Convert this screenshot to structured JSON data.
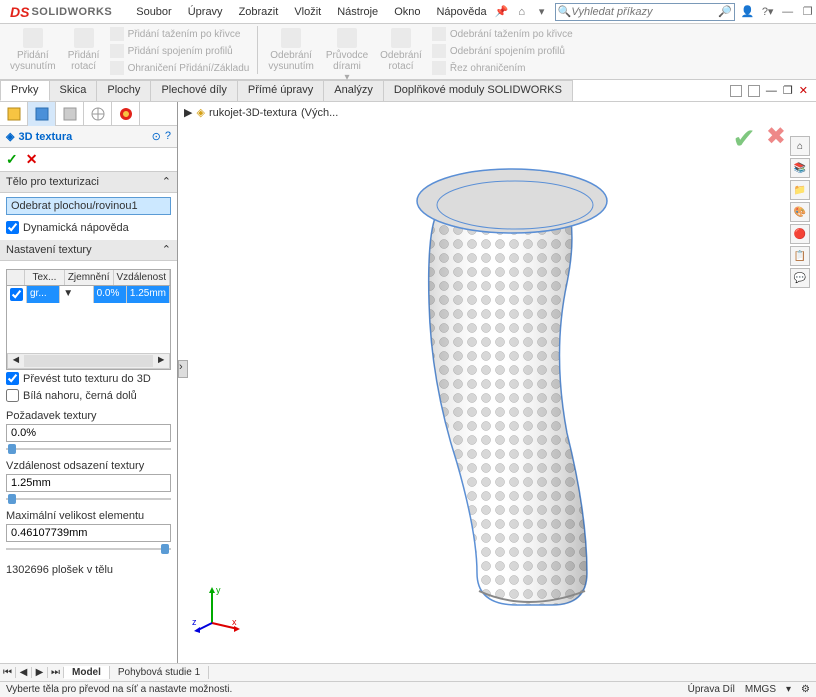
{
  "app": {
    "logo_prefix": "DS",
    "logo_name": "SOLIDWORKS"
  },
  "menu": [
    "Soubor",
    "Úpravy",
    "Zobrazit",
    "Vložit",
    "Nástroje",
    "Okno",
    "Nápověda"
  ],
  "search": {
    "placeholder": "Vyhledat příkazy"
  },
  "ribbon": {
    "left_btns": [
      {
        "label1": "Přidání",
        "label2": "vysunutím"
      },
      {
        "label1": "Přidání",
        "label2": "rotací"
      }
    ],
    "left_list": [
      "Přidání tažením po křivce",
      "Přidání spojením profilů",
      "Ohraničení Přidání/Základu"
    ],
    "mid_btns": [
      {
        "label1": "Odebrání",
        "label2": "vysunutím"
      },
      {
        "label1": "Průvodce",
        "label2": "dírami"
      },
      {
        "label1": "Odebrání",
        "label2": "rotací"
      }
    ],
    "right_list": [
      "Odebrání tažením po křivce",
      "Odebrání spojením profilů",
      "Řez ohraničením"
    ]
  },
  "tabs": [
    "Prvky",
    "Skica",
    "Plochy",
    "Plechové díly",
    "Přímé úpravy",
    "Analýzy",
    "Doplňkové moduly SOLIDWORKS"
  ],
  "feature": {
    "title": "3D textura",
    "section_body": {
      "title": "Tělo pro texturizaci",
      "selection": "Odebrat plochou/rovinou1",
      "dyn_help": "Dynamická nápověda"
    },
    "tex_settings": {
      "title": "Nastavení textury",
      "headers": [
        "",
        "Tex...",
        "Zjemnění",
        "Vzdálenost"
      ],
      "row": [
        "✓",
        "gr...",
        "0.0%",
        "1.25mm"
      ]
    },
    "opts": {
      "convert": "Převést tuto texturu do 3D",
      "whiteblack": "Bílá nahoru, černá dolů"
    },
    "props": {
      "p1_label": "Požadavek textury",
      "p1_value": "0.0%",
      "p2_label": "Vzdálenost odsazení textury",
      "p2_value": "1.25mm",
      "p3_label": "Maximální velikost elementu",
      "p3_value": "0.46107739mm"
    },
    "info": "1302696 plošek v tělu"
  },
  "breadcrumb": {
    "doc": "rukojet-3D-textura",
    "config": "(Vých..."
  },
  "btm_tabs": [
    "Model",
    "Pohybová studie 1"
  ],
  "status_bar": {
    "left": "Vyberte těla pro převod na síť a nastavte možnosti.",
    "edit": "Úprava Díl",
    "units": "MMGS"
  },
  "triad": {
    "x": "x",
    "y": "y",
    "z": "z"
  }
}
